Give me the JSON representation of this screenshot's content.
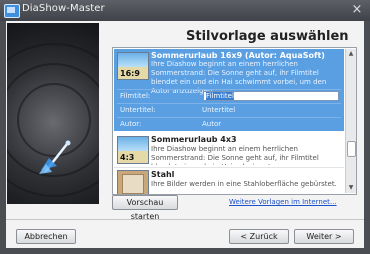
{
  "window": {
    "title": "DiaShow-Master",
    "close_label": "×"
  },
  "page": {
    "heading": "Stilvorlage auswählen"
  },
  "templates": [
    {
      "title": "Sommerurlaub 16x9 (Autor: AquaSoft)",
      "thumb_label": "16:9",
      "description": "Ihre Diashow beginnt an einem herrlichen Sommerstrand: Die Sonne geht auf, ihr Filmtitel blendet ein und ein Hai schwimmt vorbei, um den Autor anzuzeigen.",
      "selected": true
    },
    {
      "title": "Sommerurlaub 4x3",
      "thumb_label": "4:3",
      "description": "Ihre Diashow beginnt an einem herrlichen Sommerstrand: Die Sonne geht auf, ihr Filmtitel blendet ein und ein Hai schwimmt",
      "selected": false
    },
    {
      "title": "Stahl",
      "thumb_label": "",
      "description": "Ihre Bilder werden in eine Stahloberfläche gebürstet.",
      "selected": false
    }
  ],
  "fields": [
    {
      "label": "Filmtitel:",
      "value": "Filmtitel"
    },
    {
      "label": "Untertitel:",
      "value": "Untertitel"
    },
    {
      "label": "Autor:",
      "value": "Autor"
    }
  ],
  "buttons": {
    "preview": "Vorschau starten",
    "cancel": "Abbrechen",
    "back": "< Zurück",
    "next": "Weiter >"
  },
  "link": {
    "more_templates": "Weitere Vorlagen im Internet..."
  },
  "colors": {
    "selection": "#5a9fe2",
    "link": "#1c52c9",
    "titlebar": "#4a4d52"
  }
}
